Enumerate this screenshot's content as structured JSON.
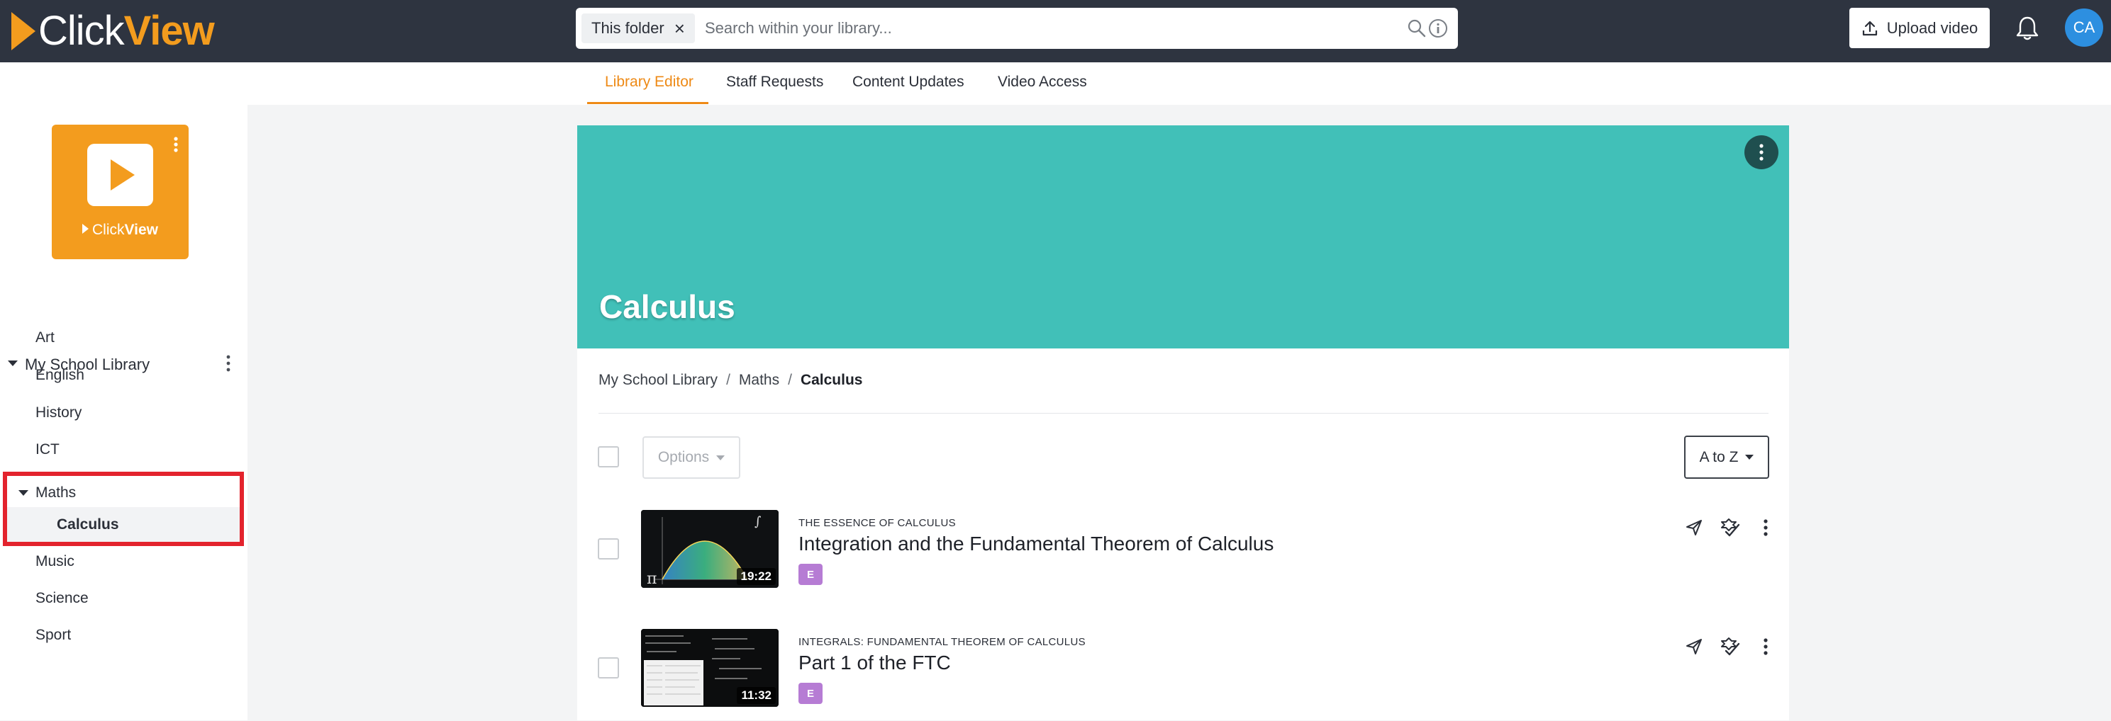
{
  "app": {
    "brand_click": "Click",
    "brand_view": "View"
  },
  "search": {
    "scope_chip": "This folder",
    "placeholder": "Search within your library..."
  },
  "header": {
    "upload_label": "Upload video",
    "avatar_initials": "CA"
  },
  "library_logo": {
    "brand_click": "Click",
    "brand_view": "View"
  },
  "sidebar": {
    "root_label": "My School Library",
    "items": [
      {
        "label": "Art"
      },
      {
        "label": "English"
      },
      {
        "label": "History"
      },
      {
        "label": "ICT"
      },
      {
        "label": "Maths"
      },
      {
        "label": "Calculus"
      },
      {
        "label": "Music"
      },
      {
        "label": "Science"
      },
      {
        "label": "Sport"
      }
    ]
  },
  "tabs": [
    {
      "label": "Library Editor",
      "active": true
    },
    {
      "label": "Staff Requests"
    },
    {
      "label": "Content Updates"
    },
    {
      "label": "Video Access"
    }
  ],
  "folder": {
    "title": "Calculus"
  },
  "breadcrumb": [
    "My School Library",
    "Maths",
    "Calculus"
  ],
  "toolbar": {
    "options_label": "Options",
    "sort_label": "A to Z"
  },
  "videos": [
    {
      "series": "THE ESSENCE OF CALCULUS",
      "title": "Integration and the Fundamental Theorem of Calculus",
      "duration": "19:22",
      "badge": "E"
    },
    {
      "series": "INTEGRALS: FUNDAMENTAL THEOREM OF CALCULUS",
      "title": "Part 1 of the FTC",
      "duration": "11:32",
      "badge": "E"
    }
  ],
  "colors": {
    "accent": "#ee8a16",
    "banner": "#41c0b8",
    "topbar": "#2e3440",
    "highlight": "#e3232d",
    "badge": "#b67cd4"
  }
}
